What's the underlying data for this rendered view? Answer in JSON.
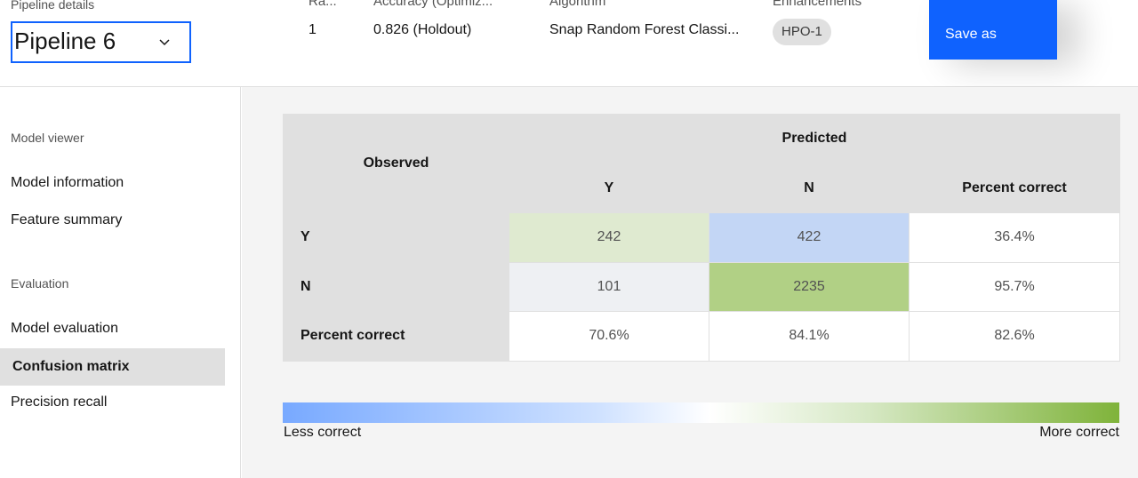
{
  "header": {
    "pipeline_details_label": "Pipeline details",
    "pipeline_selected": "Pipeline 6",
    "columns": [
      {
        "head": "Ra...",
        "value": "1"
      },
      {
        "head": "Accuracy (Optimiz...",
        "value": "0.826 (Holdout)"
      },
      {
        "head": "Algorithm",
        "value": "Snap Random Forest Classi..."
      },
      {
        "head": "Enhancements",
        "value": "HPO-1"
      }
    ],
    "save_as_label": "Save as"
  },
  "sidebar": {
    "section_model_viewer": "Model viewer",
    "section_evaluation": "Evaluation",
    "items": [
      {
        "label": "Model information"
      },
      {
        "label": "Feature summary"
      },
      {
        "label": "Model evaluation"
      },
      {
        "label": "Confusion matrix",
        "active": true
      },
      {
        "label": "Precision recall"
      }
    ]
  },
  "matrix": {
    "observed_label": "Observed",
    "predicted_label": "Predicted",
    "col_y": "Y",
    "col_n": "N",
    "col_percent": "Percent correct",
    "rows": [
      {
        "label": "Y",
        "y": "242",
        "n": "422",
        "pct": "36.4%"
      },
      {
        "label": "N",
        "y": "101",
        "n": "2235",
        "pct": "95.7%"
      },
      {
        "label": "Percent correct",
        "y": "70.6%",
        "n": "84.1%",
        "pct": "82.6%"
      }
    ],
    "cell_colors": {
      "yy": "#dfead0",
      "yn": "#c3d6f5",
      "ny": "#eef0f3",
      "nn": "#b1d085"
    }
  },
  "legend": {
    "less": "Less correct",
    "more": "More correct",
    "color_low": "#78a9ff",
    "color_high": "#7fb33a"
  }
}
